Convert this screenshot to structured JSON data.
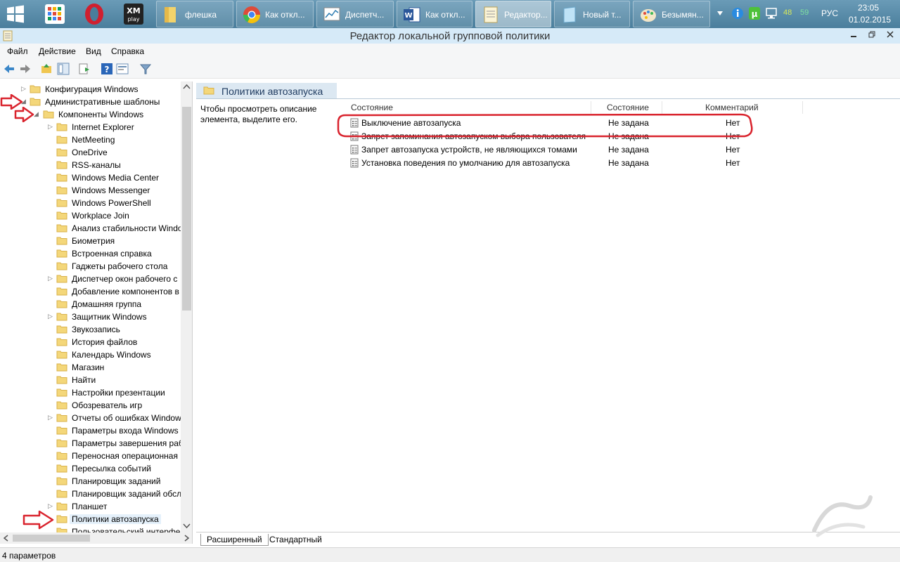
{
  "taskbar": {
    "buttons": [
      {
        "label": "флешка"
      },
      {
        "label": "Как откл..."
      },
      {
        "label": "Диспетч..."
      },
      {
        "label": "Как откл..."
      },
      {
        "label": "Редактор..."
      },
      {
        "label": "Новый т..."
      },
      {
        "label": "Безымян..."
      }
    ],
    "tray": {
      "num1": "48",
      "num2": "59",
      "lang": "РУС",
      "time": "23:05",
      "date": "01.02.2015"
    }
  },
  "window": {
    "title": "Редактор локальной групповой политики"
  },
  "menu": {
    "file": "Файл",
    "action": "Действие",
    "view": "Вид",
    "help": "Справка"
  },
  "tree": {
    "items": [
      {
        "label": "Конфигурация Windows"
      },
      {
        "label": "Административные шаблоны"
      },
      {
        "label": "Компоненты Windows"
      },
      {
        "label": "Internet Explorer"
      },
      {
        "label": "NetMeeting"
      },
      {
        "label": "OneDrive"
      },
      {
        "label": "RSS-каналы"
      },
      {
        "label": "Windows Media Center"
      },
      {
        "label": "Windows Messenger"
      },
      {
        "label": "Windows PowerShell"
      },
      {
        "label": "Workplace Join"
      },
      {
        "label": "Анализ стабильности Windo"
      },
      {
        "label": "Биометрия"
      },
      {
        "label": "Встроенная справка"
      },
      {
        "label": "Гаджеты рабочего стола"
      },
      {
        "label": "Диспетчер окон рабочего с"
      },
      {
        "label": "Добавление компонентов в"
      },
      {
        "label": "Домашняя группа"
      },
      {
        "label": "Защитник Windows"
      },
      {
        "label": "Звукозапись"
      },
      {
        "label": "История файлов"
      },
      {
        "label": "Календарь Windows"
      },
      {
        "label": "Магазин"
      },
      {
        "label": "Найти"
      },
      {
        "label": "Настройки презентации"
      },
      {
        "label": "Обозреватель игр"
      },
      {
        "label": "Отчеты об ошибках Window"
      },
      {
        "label": "Параметры входа Windows"
      },
      {
        "label": "Параметры завершения раб"
      },
      {
        "label": "Переносная операционная"
      },
      {
        "label": "Пересылка событий"
      },
      {
        "label": "Планировщик заданий"
      },
      {
        "label": "Планировщик заданий обсл"
      },
      {
        "label": "Планшет"
      },
      {
        "label": "Политики автозапуска"
      },
      {
        "label": "Пользовательский интерфе"
      }
    ]
  },
  "right": {
    "title": "Политики автозапуска",
    "description": "Чтобы просмотреть описание элемента, выделите его.",
    "columns": {
      "name": "Состояние",
      "state": "Состояние",
      "comment": "Комментарий"
    },
    "policies": [
      {
        "name": "Выключение автозапуска",
        "state": "Не задана",
        "comment": "Нет"
      },
      {
        "name": "Запрет запоминания автозапуском выбора пользователя.",
        "state": "Не задана",
        "comment": "Нет"
      },
      {
        "name": "Запрет автозапуска устройств, не являющихся томами",
        "state": "Не задана",
        "comment": "Нет"
      },
      {
        "name": "Установка поведения по умолчанию для автозапуска",
        "state": "Не задана",
        "comment": "Нет"
      }
    ]
  },
  "tabs": {
    "extended": "Расширенный",
    "standard": "Стандартный"
  },
  "status": {
    "text": "4 параметров"
  },
  "colors": {
    "annotation_red": "#d9232d",
    "folder_yellow": "#f4d77a",
    "selection_blue": "#e5f1fb"
  }
}
